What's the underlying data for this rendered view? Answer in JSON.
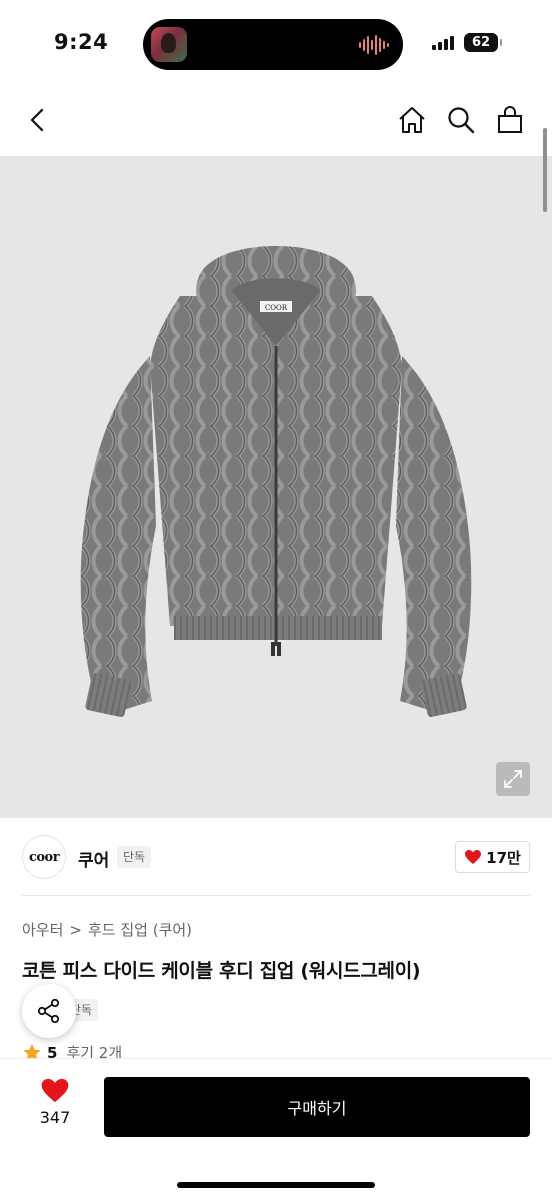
{
  "status_bar": {
    "time": "9:24",
    "battery": "62"
  },
  "nav": {
    "back_icon": "chevron-left-icon",
    "home_icon": "home-icon",
    "search_icon": "search-icon",
    "bag_icon": "shopping-bag-icon"
  },
  "hero": {
    "label_text": "COOR",
    "expand_icon": "expand-icon"
  },
  "shop": {
    "logo_text": "coor",
    "name": "쿠어",
    "badge": "단독",
    "likes": "17만"
  },
  "breadcrumb": {
    "category": "아우터",
    "separator": ">",
    "subcategory": "후드 집업 (쿠어)"
  },
  "product": {
    "title": "코튼 피스 다이드 케이블 후디 집업 (워시드그레이)",
    "tag": "단독",
    "rating": "5",
    "reviews": "후기 2개"
  },
  "bottom": {
    "wish_count": "347",
    "buy_label": "구매하기"
  },
  "colors": {
    "heart": "#e3161e",
    "star": "#f5a623",
    "buy_bg": "#000000"
  }
}
